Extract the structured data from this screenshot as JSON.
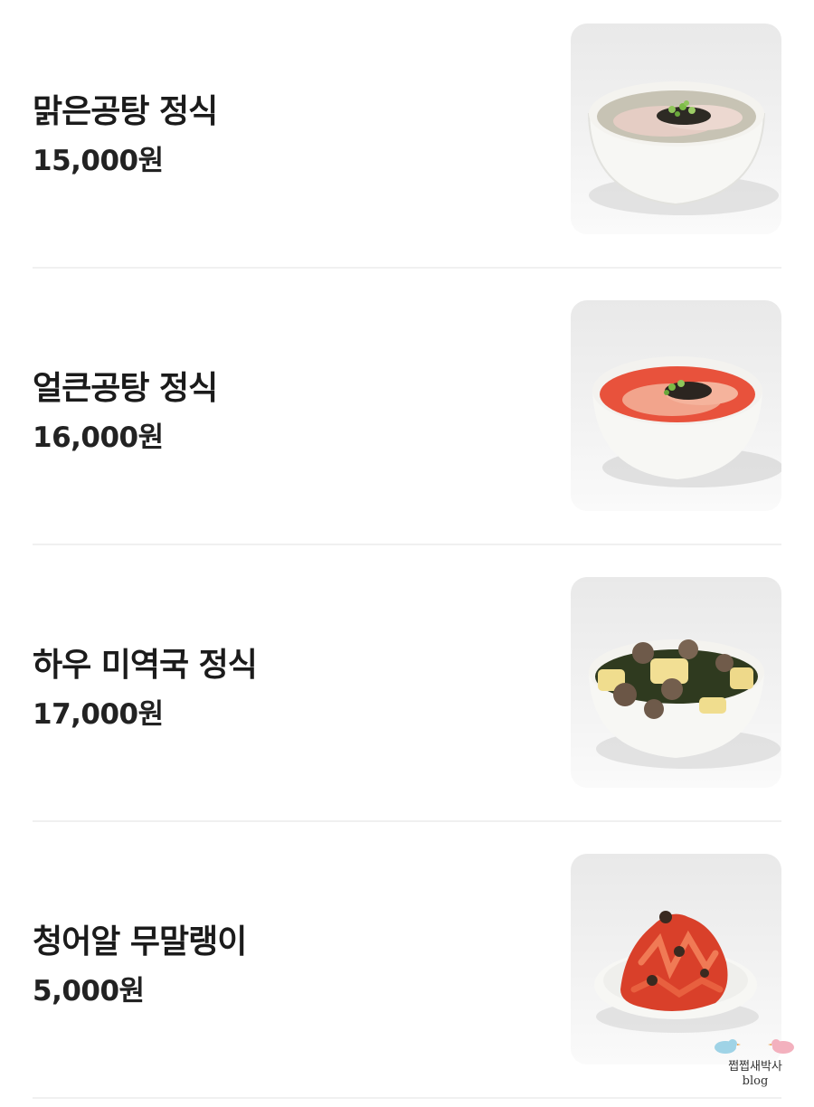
{
  "menu": {
    "items": [
      {
        "name": "맑은공탕 정식",
        "price": "15,000원",
        "image": "clear-gomtang-bowl"
      },
      {
        "name": "얼큰공탕 정식",
        "price": "16,000원",
        "image": "spicy-gomtang-bowl"
      },
      {
        "name": "하우 미역국 정식",
        "price": "17,000원",
        "image": "seaweed-soup-bowl"
      },
      {
        "name": "청어알 무말랭이",
        "price": "5,000원",
        "image": "radish-side-dish"
      }
    ]
  },
  "watermark": {
    "title": "쩝쩝새박사",
    "subtitle": "blog"
  }
}
